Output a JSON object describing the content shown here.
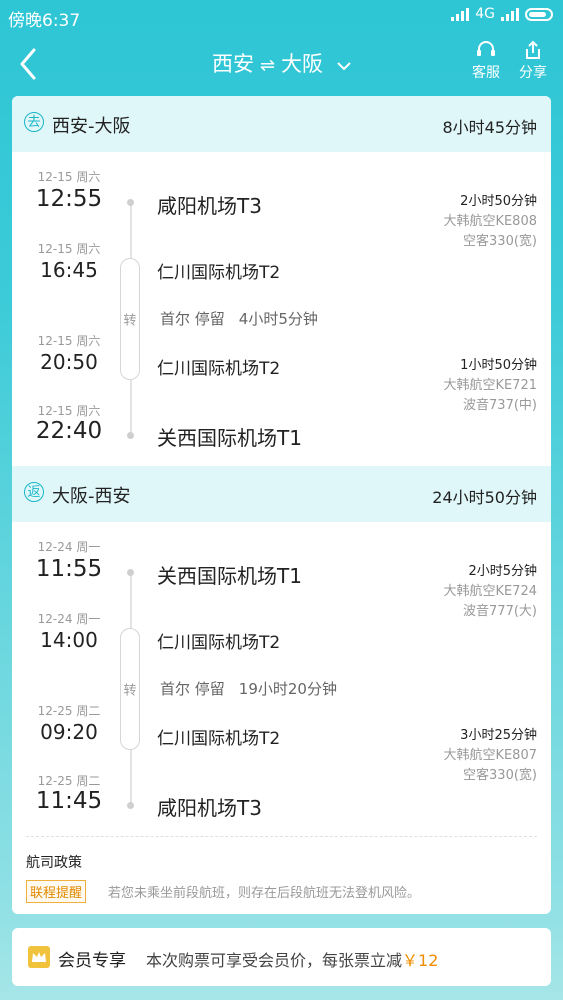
{
  "status_bar": {
    "time": "傍晚6:37",
    "network": "4G"
  },
  "nav": {
    "from": "西安",
    "to": "大阪",
    "swap_icon": "⇌",
    "actions": [
      {
        "label": "客服",
        "icon": "headset-icon"
      },
      {
        "label": "分享",
        "icon": "share-icon"
      }
    ]
  },
  "outbound": {
    "tag": "去",
    "route": "西安-大阪",
    "total_duration": "8小时45分钟",
    "stops": [
      {
        "date": "12-15 周六",
        "time": "12:55",
        "airport": "咸阳机场T3"
      },
      {
        "date": "12-15 周六",
        "time": "16:45",
        "airport": "仁川国际机场T2"
      },
      {
        "date": "12-15 周六",
        "time": "20:50",
        "airport": "仁川国际机场T2"
      },
      {
        "date": "12-15 周六",
        "time": "22:40",
        "airport": "关西国际机场T1"
      }
    ],
    "legs": [
      {
        "duration": "2小时50分钟",
        "flight": "大韩航空KE808",
        "aircraft": "空客330(宽)"
      },
      {
        "duration": "1小时50分钟",
        "flight": "大韩航空KE721",
        "aircraft": "波音737(中)"
      }
    ],
    "transfer": {
      "label": "转",
      "city": "首尔 停留",
      "duration": "4小时5分钟"
    }
  },
  "return": {
    "tag": "返",
    "route": "大阪-西安",
    "total_duration": "24小时50分钟",
    "stops": [
      {
        "date": "12-24 周一",
        "time": "11:55",
        "airport": "关西国际机场T1"
      },
      {
        "date": "12-24 周一",
        "time": "14:00",
        "airport": "仁川国际机场T2"
      },
      {
        "date": "12-25 周二",
        "time": "09:20",
        "airport": "仁川国际机场T2"
      },
      {
        "date": "12-25 周二",
        "time": "11:45",
        "airport": "咸阳机场T3"
      }
    ],
    "legs": [
      {
        "duration": "2小时5分钟",
        "flight": "大韩航空KE724",
        "aircraft": "波音777(大)"
      },
      {
        "duration": "3小时25分钟",
        "flight": "大韩航空KE807",
        "aircraft": "空客330(宽)"
      }
    ],
    "transfer": {
      "label": "转",
      "city": "首尔 停留",
      "duration": "19小时20分钟"
    }
  },
  "policy": {
    "title": "航司政策",
    "badge": "联程提醒",
    "text": "若您未乘坐前段航班，则存在后段航班无法登机风险。"
  },
  "member": {
    "title": "会员专享",
    "desc": "本次购票可享受会员价，每张票立减",
    "price": "￥12"
  },
  "colors": {
    "accent": "#19b6c8",
    "price": "#f08c00"
  }
}
